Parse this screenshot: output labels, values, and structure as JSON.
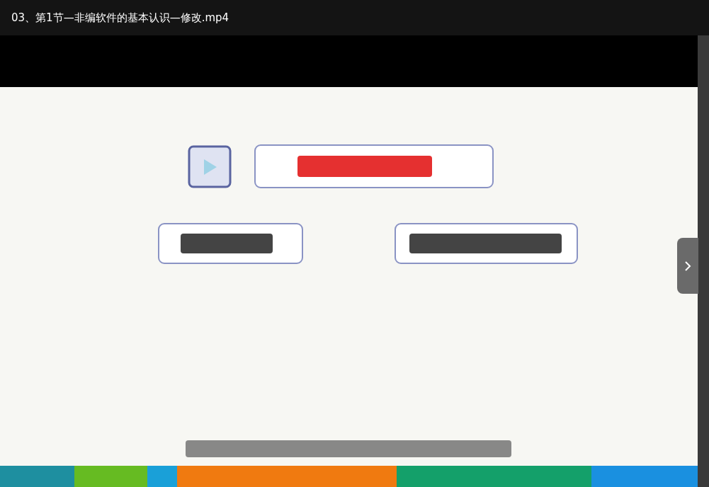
{
  "window": {
    "title": "03、第1节—非编软件的基本认识—修改.mp4"
  }
}
